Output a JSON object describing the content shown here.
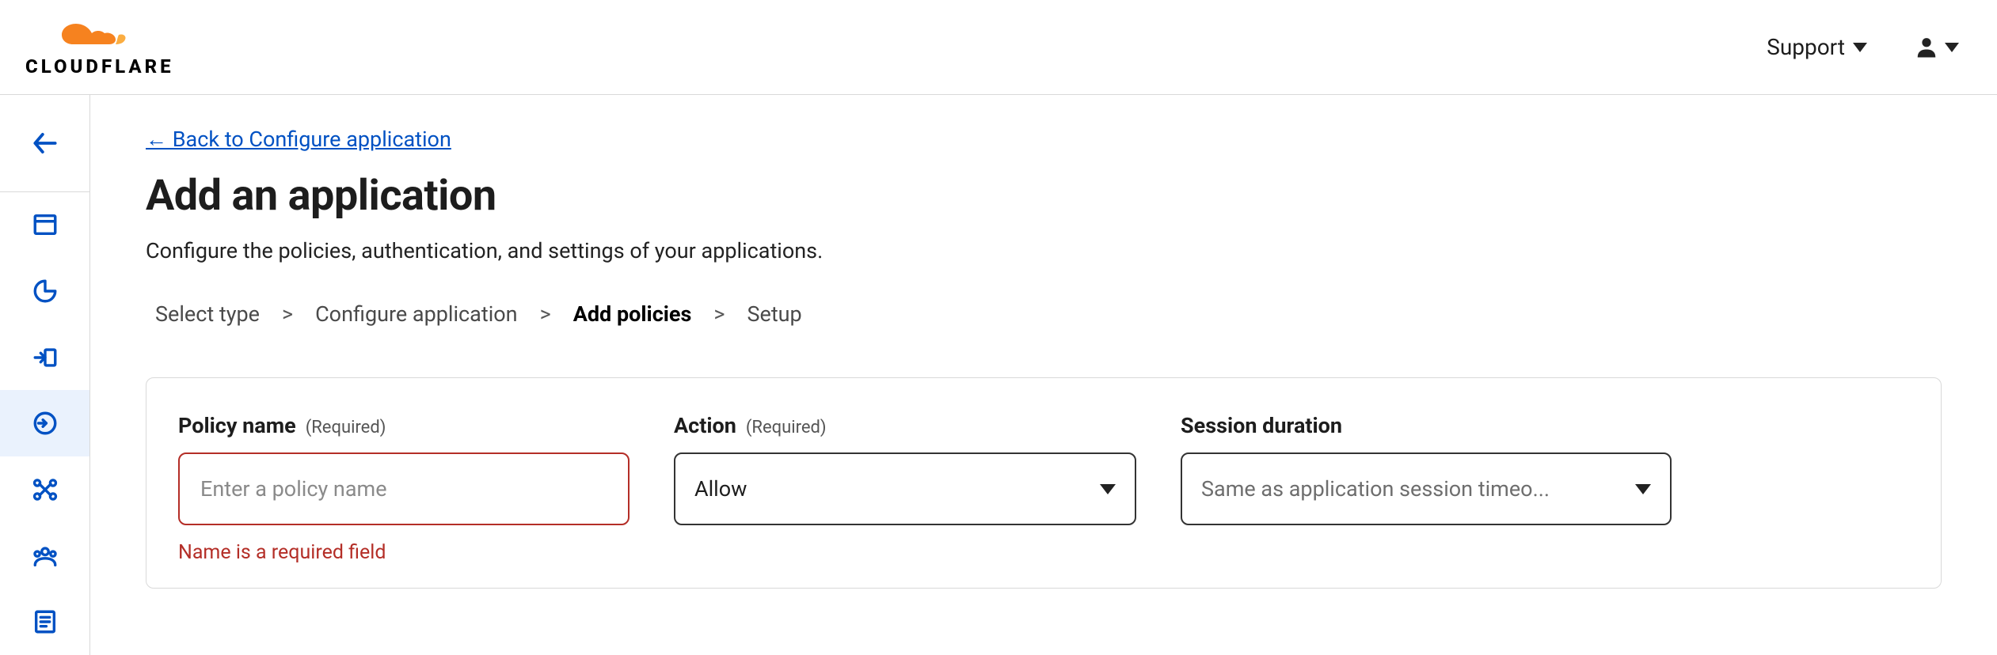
{
  "header": {
    "brand": "CLOUDFLARE",
    "support_label": "Support"
  },
  "back_link": "← Back to Configure application",
  "page_title": "Add an application",
  "page_subtitle": "Configure the policies, authentication, and settings of your applications.",
  "breadcrumb": {
    "steps": [
      "Select type",
      "Configure application",
      "Add policies",
      "Setup"
    ],
    "sep": ">",
    "current_index": 2
  },
  "form": {
    "policy_name": {
      "label": "Policy name",
      "hint": "(Required)",
      "placeholder": "Enter a policy name",
      "value": "",
      "error": "Name is a required field"
    },
    "action": {
      "label": "Action",
      "hint": "(Required)",
      "value": "Allow"
    },
    "session": {
      "label": "Session duration",
      "value": "Same as application session timeo..."
    }
  }
}
